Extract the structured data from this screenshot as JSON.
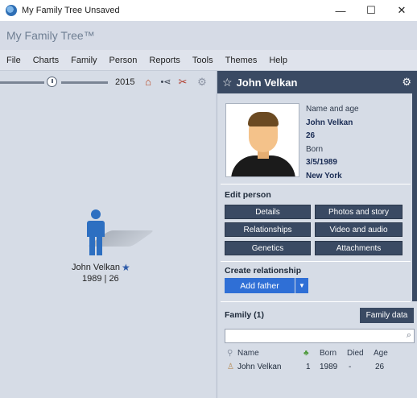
{
  "window": {
    "title": "My Family Tree Unsaved",
    "minimize": "—",
    "maximize": "☐",
    "close": "✕"
  },
  "app": {
    "title": "My Family Tree™"
  },
  "menu": [
    "File",
    "Charts",
    "Family",
    "Person",
    "Reports",
    "Tools",
    "Themes",
    "Help"
  ],
  "toolbar": {
    "year": "2015"
  },
  "tree": {
    "node": {
      "name": "John Velkan",
      "years": "1989 | 26"
    }
  },
  "person": {
    "header_name": "John Velkan",
    "name_age_label": "Name and age",
    "name": "John Velkan",
    "age": "26",
    "born_label": "Born",
    "born_date": "3/5/1989",
    "born_place": "New York"
  },
  "edit_person": {
    "title": "Edit person",
    "buttons": [
      "Details",
      "Photos and story",
      "Relationships",
      "Video and audio",
      "Genetics",
      "Attachments"
    ]
  },
  "create_relationship": {
    "title": "Create relationship",
    "add_father": "Add father",
    "dropdown": "▼"
  },
  "family": {
    "title": "Family (1)",
    "data_button": "Family data",
    "columns": {
      "name": "Name",
      "born": "Born",
      "died": "Died",
      "age": "Age"
    },
    "rows": [
      {
        "name": "John Velkan",
        "gen": "1",
        "born": "1989",
        "died": "-",
        "age": "26"
      }
    ]
  },
  "colors": {
    "panel_header": "#3a4a63",
    "accent_blue": "#2f6fd6",
    "figure_blue": "#2d6fc1"
  }
}
